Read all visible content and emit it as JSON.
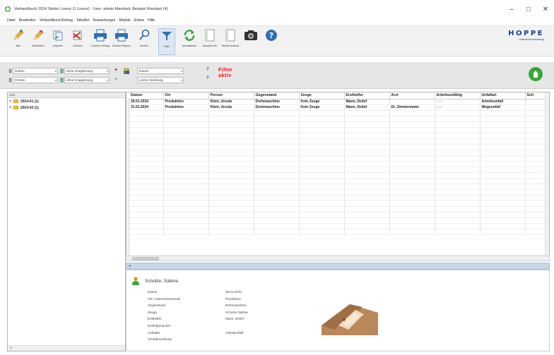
{
  "window": {
    "title": "Verbandbuch 2024 Stefan Lizenz (1 Lizenz) · User: admin Mandant: Beispiel Mandant (4)",
    "controls": {
      "minimize": "–",
      "maximize": "□",
      "close": "✕"
    }
  },
  "menu": [
    "Datei",
    "Bearbeiten",
    "Verbandbuch-Eintrag",
    "Tabellen",
    "Auswertungen",
    "Module",
    "Extras",
    "Hilfe"
  ],
  "toolbar": {
    "buttons": [
      {
        "label": "Neu",
        "icon": "pencil-new-icon"
      },
      {
        "label": "Bearbeiten",
        "icon": "pencil-edit-icon"
      },
      {
        "label": "Kopieren",
        "icon": "copy-icon"
      },
      {
        "label": "Löschen",
        "icon": "delete-icon"
      },
      {
        "label": "Drucken Eintrag",
        "icon": "printer-entry-icon"
      },
      {
        "label": "Drucken Report",
        "icon": "printer-report-icon"
      },
      {
        "label": "Suchen",
        "icon": "search-icon"
      },
      {
        "label": "Filter",
        "icon": "filter-icon",
        "active": true
      },
      {
        "label": "Aktualisieren",
        "icon": "refresh-icon"
      },
      {
        "label": "Auswahl Info",
        "icon": "selection-info-icon"
      },
      {
        "label": "Bericht Ansicht",
        "icon": "report-view-icon"
      },
      {
        "label": "",
        "icon": "camera-icon"
      },
      {
        "label": "",
        "icon": "help-icon"
      }
    ],
    "logo": {
      "main": "HOPPE",
      "sub": "Unternehmensberatung"
    }
  },
  "filter": {
    "row1": {
      "field": "Datum",
      "op": "ohne Gruppierung",
      "value": "Datum"
    },
    "row2": {
      "field": "Person",
      "op": "ohne Gruppierung",
      "value": "Letzte Änderung"
    },
    "active_line1": "Filter",
    "active_line2": "aktiv",
    "q1": "?",
    "q2": "?"
  },
  "tree": {
    "header": "Jahr",
    "items": [
      {
        "label": "2024-01  (1)"
      },
      {
        "label": "2024-02  (1)"
      }
    ],
    "scroll_left": "◂"
  },
  "grid": {
    "columns": [
      "Datum",
      "Ort",
      "Person",
      "Gegenstand",
      "Zeuge",
      "Ersthelfer",
      "Arzt",
      "Arbeitsunfähig",
      "Unfallart",
      "Sch"
    ],
    "rows": [
      [
        "29.01.2024",
        "Produktion",
        "Klein, Ursula",
        "Drehmaschine",
        "Kein Zeuge",
        "Mann, Detlef",
        "",
        "- . -",
        "Arbeitsunfall",
        ""
      ],
      [
        "31.01.2024",
        "Produktion",
        "Klein, Ursula",
        "Drehmaschine",
        "Kein Zeuge",
        "Mann, Detlef",
        "Dr. Zimmermann",
        "- . -",
        "Wegeunfall",
        ""
      ]
    ]
  },
  "detail": {
    "name": "Schulze, Sabine",
    "fields": [
      {
        "label": "Datum",
        "value": "29.01.2024"
      },
      {
        "label": "Ort / Unternehmensteil",
        "value": "Produktion"
      },
      {
        "label": "Gegenstand",
        "value": "Drehmaschine"
      },
      {
        "label": "Zeuge",
        "value": "Schulze Sabine"
      },
      {
        "label": "Ersthelfer",
        "value": "Mann, Detlef"
      },
      {
        "label": "Erstfolgenpunkt",
        "value": ""
      },
      {
        "label": "Unfallart",
        "value": "Arbeitsunfall"
      },
      {
        "label": "Schadenwirkung",
        "value": ""
      }
    ]
  },
  "colors": {
    "filter_active": "#e11111",
    "logo": "#1a3f8f",
    "splitter": "#c8d8ea",
    "export": "#3aa53a"
  }
}
